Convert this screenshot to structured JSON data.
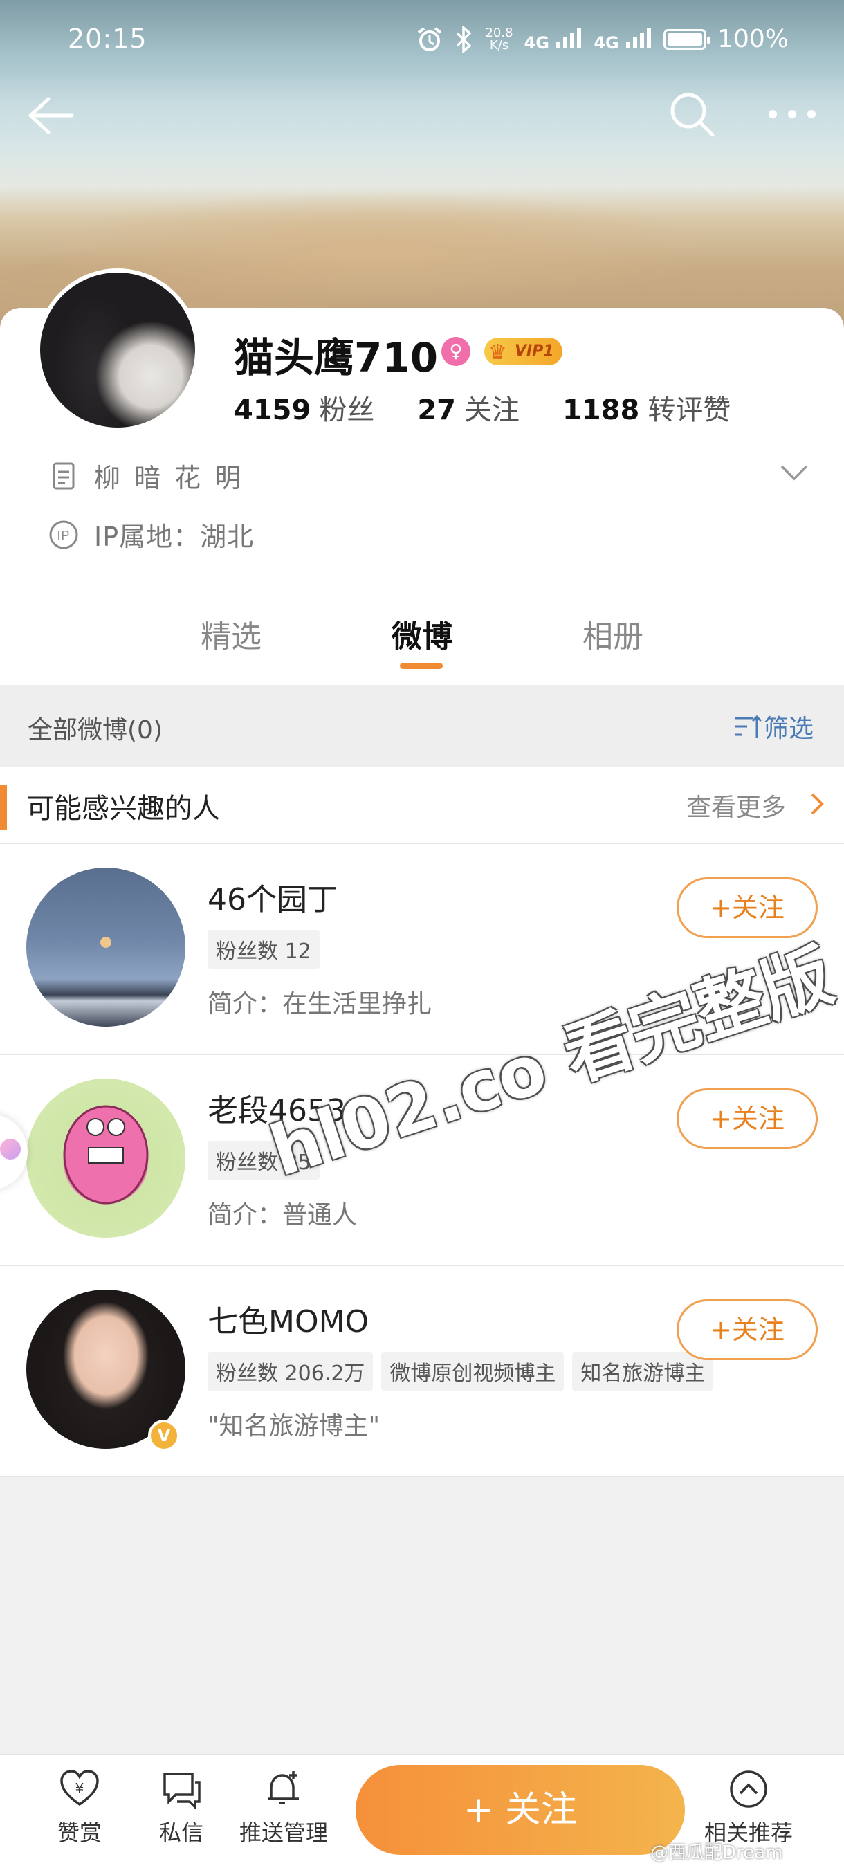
{
  "status": {
    "time": "20:15",
    "net_speed_top": "20.8",
    "net_speed_bottom": "K/s",
    "signal1": "4G",
    "signal2": "4G",
    "battery": "100%"
  },
  "profile": {
    "name": "猫头鹰710",
    "vip": "VIP1",
    "stats": [
      {
        "value": "4159",
        "label": "粉丝"
      },
      {
        "value": "27",
        "label": "关注"
      },
      {
        "value": "1188",
        "label": "转评赞"
      }
    ],
    "bio": "柳 暗 花 明",
    "ip_location": "IP属地：湖北"
  },
  "tabs": [
    "精选",
    "微博",
    "相册"
  ],
  "active_tab": "微博",
  "filter": {
    "all_posts": "全部微博(0)",
    "filter_label": "筛选"
  },
  "recommend": {
    "title": "可能感兴趣的人",
    "more": "查看更多",
    "follow_label": "+关注",
    "people": [
      {
        "name": "46个园丁",
        "tags": [
          "粉丝数 12"
        ],
        "desc": "简介：在生活里挣扎"
      },
      {
        "name": "老段4653",
        "tags": [
          "粉丝数 35"
        ],
        "desc": "简介：普通人"
      },
      {
        "name": "七色MOMO",
        "tags": [
          "粉丝数 206.2万",
          "微博原创视频博主",
          "知名旅游博主"
        ],
        "desc": "\"知名旅游博主\""
      }
    ]
  },
  "watermark": "hl02.co 看完整版",
  "bottom": {
    "reward": "赞赏",
    "message": "私信",
    "push": "推送管理",
    "follow": "+ 关注",
    "related": "相关推荐"
  },
  "credit": "@西瓜配Dream",
  "colors": {
    "accent": "#f08a33",
    "link_blue": "#4a7bb5",
    "vip_gold": "#f7c948"
  }
}
